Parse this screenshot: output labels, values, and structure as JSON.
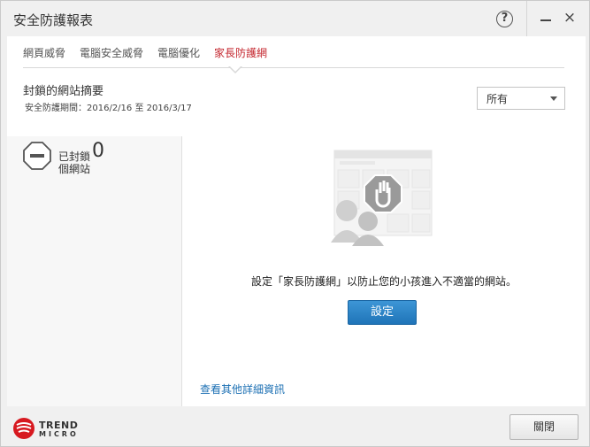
{
  "window": {
    "title": "安全防護報表",
    "help_label": "?",
    "close_glyph": "×"
  },
  "tabs": [
    {
      "label": "網頁威脅",
      "active": false
    },
    {
      "label": "電腦安全威脅",
      "active": false
    },
    {
      "label": "電腦優化",
      "active": false
    },
    {
      "label": "家長防護網",
      "active": true
    }
  ],
  "summary": {
    "title": "封鎖的網站摘要",
    "period": "安全防護期間：2016/2/16 至 2016/3/17",
    "filter_value": "所有"
  },
  "blocked": {
    "count": "0",
    "label_line1": "已封鎖",
    "label_line2": "個網站"
  },
  "main": {
    "description": "設定「家長防護網」以防止您的小孩進入不適當的網站。",
    "setup_button": "設定",
    "details_link": "查看其他詳細資訊"
  },
  "footer": {
    "logo_line1": "TREND",
    "logo_line2": "MICRO",
    "close_button": "關閉"
  },
  "colors": {
    "accent_active_tab": "#c4262e",
    "primary_button": "#2b82c7",
    "link": "#1b6fb3",
    "logo_red": "#d71920"
  }
}
